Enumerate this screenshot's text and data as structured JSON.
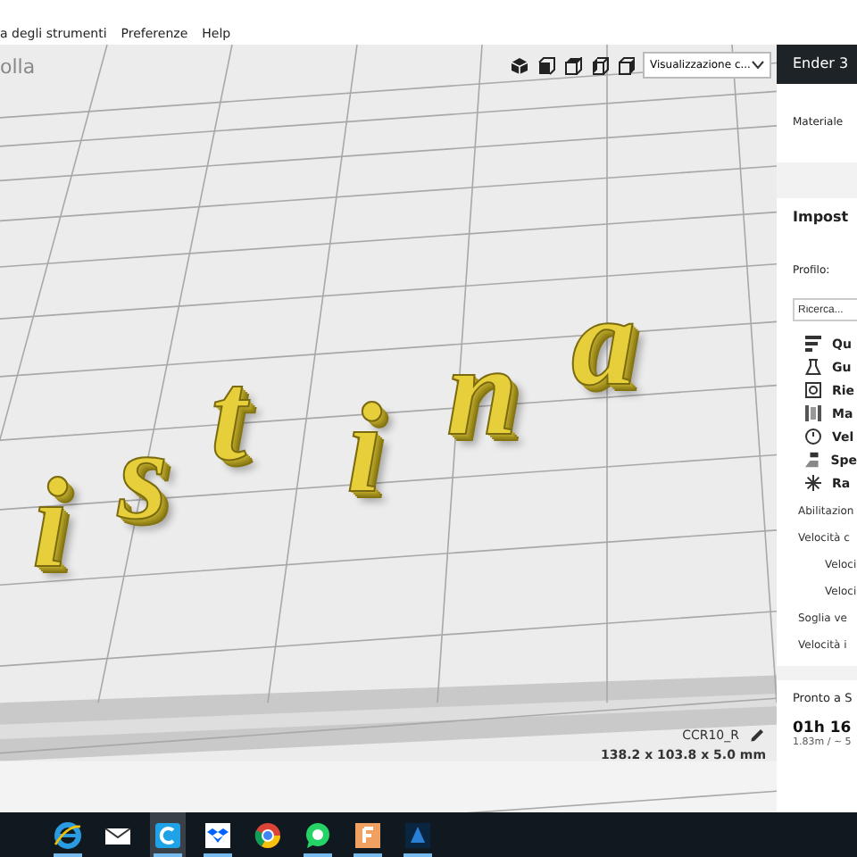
{
  "menu": [
    "a degli strumenti",
    "Preferenze",
    "Help"
  ],
  "viewport": {
    "title": "olla",
    "view_mode": "Visualizzazione c...",
    "model_letters": [
      "i",
      "s",
      "t",
      "i",
      "n",
      "a"
    ],
    "object_name": "CCR10_R",
    "dimensions": "138.2 x 103.8 x 5.0 mm"
  },
  "view_buttons": [
    {
      "kind": "perspective"
    },
    {
      "kind": "front"
    },
    {
      "kind": "top"
    },
    {
      "kind": "left"
    },
    {
      "kind": "right"
    }
  ],
  "sidebar": {
    "printer": "Ender 3",
    "material_label": "Materiale",
    "settings_title": "Impost",
    "profile_label": "Profilo:",
    "search": {
      "placeholder": "Ricerca..."
    },
    "categories": [
      {
        "label": "Qu",
        "kind": "quality"
      },
      {
        "label": "Gu",
        "kind": "shell"
      },
      {
        "label": "Rie",
        "kind": "infill"
      },
      {
        "label": "Ma",
        "kind": "material"
      },
      {
        "label": "Vel",
        "kind": "speed"
      },
      {
        "label": "Spe",
        "kind": "travel"
      },
      {
        "label": "Ra",
        "kind": "cooling"
      }
    ],
    "settings": [
      {
        "label": "Abilitazion"
      },
      {
        "label": "Velocità c",
        "children": [
          {
            "label": "Veloci"
          },
          {
            "label": "Veloci"
          }
        ]
      },
      {
        "label": "Soglia ve"
      },
      {
        "label": "Velocità i"
      }
    ],
    "status": "Pronto a S",
    "print_time": "01h 16",
    "estimate": "1.83m / ~ 5"
  },
  "taskbar": [
    {
      "kind": "ie",
      "running": true,
      "selected": false
    },
    {
      "kind": "mail",
      "running": false,
      "selected": false
    },
    {
      "kind": "cura",
      "running": true,
      "selected": true
    },
    {
      "kind": "dropbox",
      "running": true,
      "selected": false
    },
    {
      "kind": "chrome",
      "running": false,
      "selected": false
    },
    {
      "kind": "whatsapp",
      "running": true,
      "selected": false
    },
    {
      "kind": "fapp",
      "running": true,
      "selected": false
    },
    {
      "kind": "blueapp",
      "running": true,
      "selected": false
    }
  ]
}
